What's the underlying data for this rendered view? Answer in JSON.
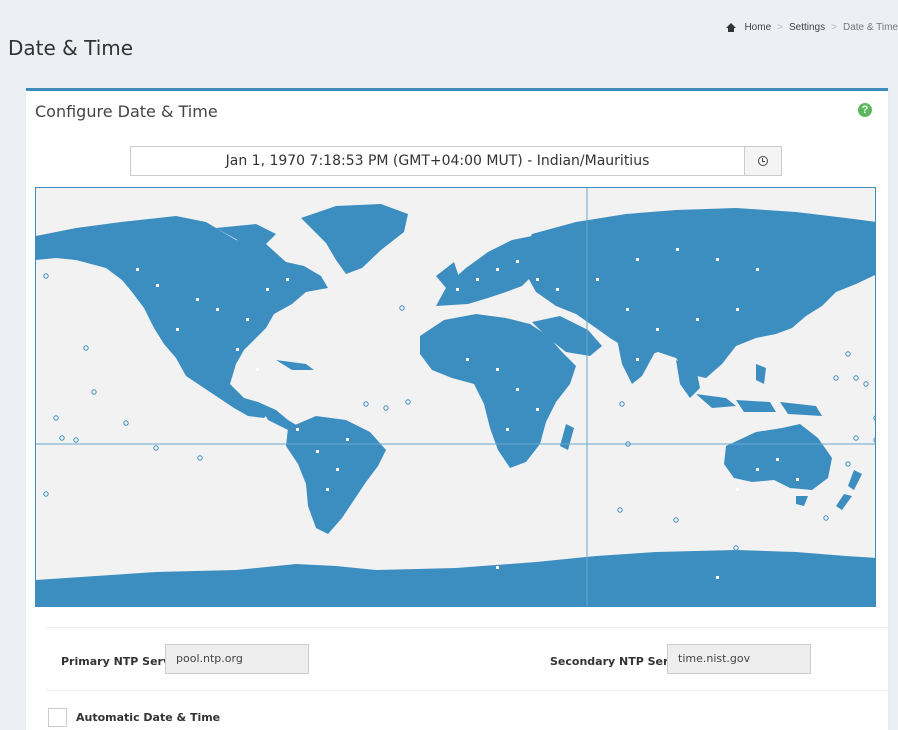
{
  "page": {
    "title": "Date & Time"
  },
  "breadcrumb": {
    "home_icon": "home-icon",
    "items": [
      "Home",
      "Settings",
      "Date & Time"
    ]
  },
  "box": {
    "title": "Configure Date & Time",
    "help_icon": "question-circle-icon",
    "help_glyph": "?"
  },
  "datetime": {
    "display": "Jan 1, 1970 7:18:53 PM (GMT+04:00 MUT)  -  Indian/Mauritius",
    "button_icon": "clock-icon"
  },
  "map": {
    "land_color": "#3d8ec0",
    "ocean_color": "#f2f2f2"
  },
  "ntp": {
    "primary_label": "Primary NTP Server",
    "primary_value": "pool.ntp.org",
    "secondary_label": "Secondary NTP Server",
    "secondary_value": "time.nist.gov"
  },
  "auto": {
    "label": "Automatic Date & Time",
    "checked": false
  },
  "colors": {
    "accent": "#3c8dbc",
    "help": "#5cb85c"
  }
}
